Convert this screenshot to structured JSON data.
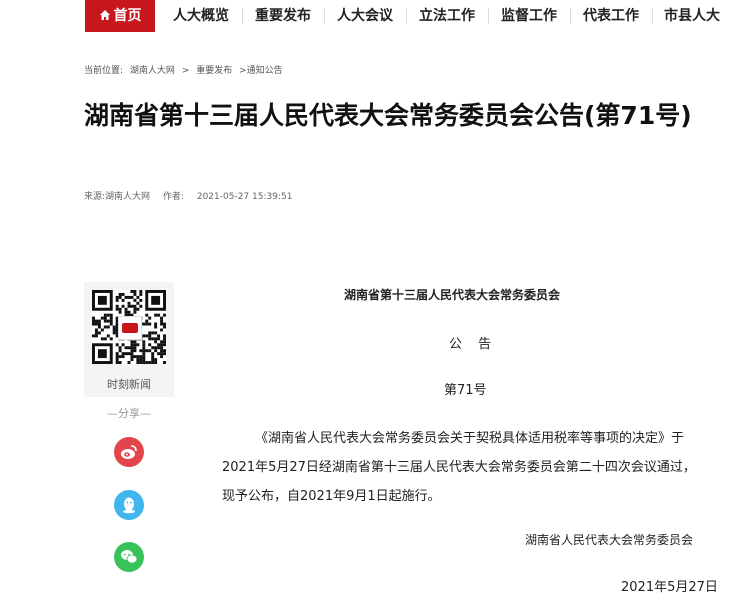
{
  "nav": {
    "items": [
      {
        "label": "首页",
        "icon": "home-icon",
        "active": true
      },
      {
        "label": "人大概览"
      },
      {
        "label": "重要发布"
      },
      {
        "label": "人大会议"
      },
      {
        "label": "立法工作"
      },
      {
        "label": "监督工作"
      },
      {
        "label": "代表工作"
      },
      {
        "label": "市县人大"
      }
    ],
    "accent": "#c8161d"
  },
  "breadcrumb": {
    "prefix": "当前位置:",
    "items": [
      "湖南人大网",
      ">",
      "重要发布",
      ">通知公告"
    ]
  },
  "article": {
    "title": "湖南省第十三届人民代表大会常务委员会公告(第71号)",
    "source": "来源:湖南人大网",
    "author": "作者:",
    "time": "2021-05-27 15:39:51",
    "org": "湖南省第十三届人民代表大会常务委员会",
    "heading": "公 告",
    "number": "第71号",
    "body": [
      "《湖南省人民代表大会常务委员会关于契税具体适用税率等事项的决定》于",
      "2021年5月27日经湖南省第十三届人民代表大会常务委员会第二十四次会议通过，",
      "现予公布，自2021年9月1日起施行。"
    ],
    "signature": "湖南省人民代表大会常务委员会",
    "date": "2021年5月27日"
  },
  "sidebar": {
    "qr_caption": "时刻新闻",
    "qr_logo_text": "时刻",
    "share_label": "—分享—",
    "share_buttons": [
      {
        "name": "weibo",
        "icon": "weibo-icon",
        "color": "#e2454a"
      },
      {
        "name": "qq",
        "icon": "qq-icon",
        "color": "#3fb6ed"
      },
      {
        "name": "wechat",
        "icon": "wechat-icon",
        "color": "#37c35a"
      }
    ]
  }
}
